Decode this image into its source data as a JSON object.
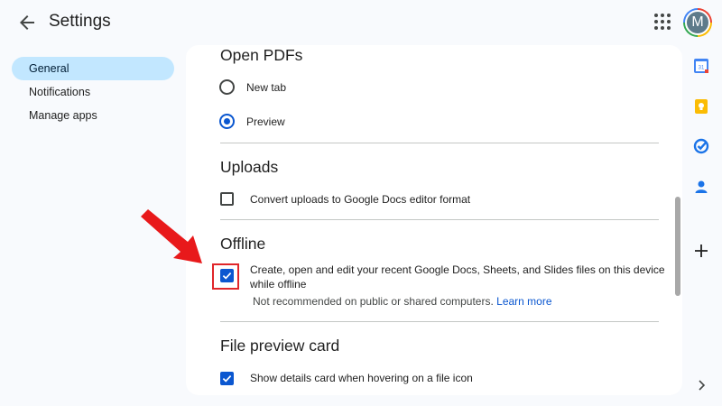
{
  "header": {
    "title": "Settings",
    "avatar_letter": "M"
  },
  "nav": {
    "items": [
      {
        "label": "General",
        "active": true
      },
      {
        "label": "Notifications",
        "active": false
      },
      {
        "label": "Manage apps",
        "active": false
      }
    ]
  },
  "sections": {
    "open_pdfs": {
      "title": "Open PDFs",
      "options": [
        {
          "label": "New tab",
          "selected": false
        },
        {
          "label": "Preview",
          "selected": true
        }
      ]
    },
    "uploads": {
      "title": "Uploads",
      "convert_label": "Convert uploads to Google Docs editor format",
      "convert_checked": false
    },
    "offline": {
      "title": "Offline",
      "label_line1": "Create, open and edit your recent Google Docs, Sheets, and Slides files on this device",
      "label_line2": "while offline",
      "checked": true,
      "note": "Not recommended on public or shared computers.",
      "learn_more": "Learn more"
    },
    "file_preview": {
      "title": "File preview card",
      "label": "Show details card when hovering on a file icon",
      "checked": true
    }
  },
  "side_panel": {
    "icons": [
      "calendar-icon",
      "keep-icon",
      "tasks-icon",
      "contacts-icon",
      "add-icon"
    ],
    "calendar_day": "31"
  },
  "colors": {
    "accent": "#0b57d0",
    "nav_active": "#c2e7ff",
    "annotation_red": "#e0262a"
  }
}
